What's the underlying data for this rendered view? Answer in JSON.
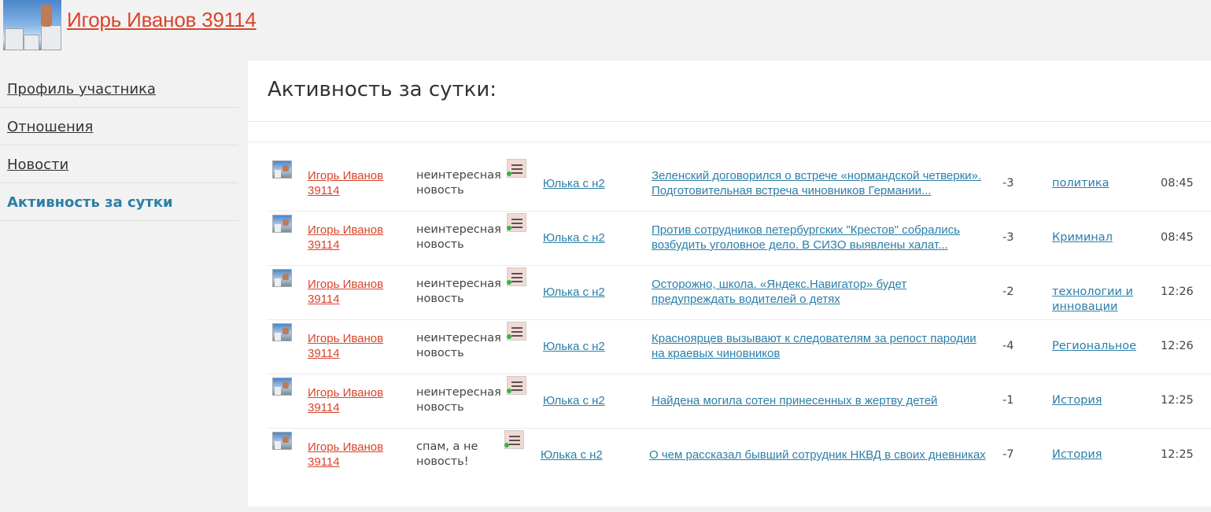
{
  "header": {
    "user_name": "Игорь Иванов 39114"
  },
  "sidebar": {
    "items": [
      {
        "label": "Профиль участника",
        "active": false
      },
      {
        "label": "Отношения",
        "active": false
      },
      {
        "label": "Новости",
        "active": false
      },
      {
        "label": "Активность за сутки",
        "active": true
      }
    ]
  },
  "main": {
    "title": "Активность за сутки:",
    "rows": [
      {
        "user": "Игорь Иванов 39114",
        "reason": "неинтересная новость",
        "voter": "Юлька с н2",
        "news": "Зеленский договорился о встрече «нормандской четверки». Подготовительная встреча чиновников Германии...",
        "score": "-3",
        "category": "политика",
        "time": "08:45"
      },
      {
        "user": "Игорь Иванов 39114",
        "reason": "неинтересная новость",
        "voter": "Юлька с н2",
        "news": "Против сотрудников петербургских \"Крестов\" собрались возбудить уголовное дело. В СИЗО выявлены халат...",
        "score": "-3",
        "category": "Криминал",
        "time": "08:45"
      },
      {
        "user": "Игорь Иванов 39114",
        "reason": "неинтересная новость",
        "voter": "Юлька с н2",
        "news": "Осторожно, школа. «Яндекс.Навигатор» будет предупреждать водителей о детях",
        "score": "-2",
        "category": "технологии и инновации",
        "time": "12:26"
      },
      {
        "user": "Игорь Иванов 39114",
        "reason": "неинтересная новость",
        "voter": "Юлька с н2",
        "news": "Красноярцев вызывают к следователям за репост пародии на краевых чиновников",
        "score": "-4",
        "category": "Региональное",
        "time": "12:26"
      },
      {
        "user": "Игорь Иванов 39114",
        "reason": "неинтересная новость",
        "voter": "Юлька с н2",
        "news": "Найдена могила сотен принесенных в жертву детей",
        "score": "-1",
        "category": "История",
        "time": "12:25"
      },
      {
        "user": "Игорь Иванов 39114",
        "reason": "спам, а не новость!",
        "voter": "Юлька с н2",
        "news": "О чем рассказал бывший сотрудник НКВД в своих дневниках",
        "score": "-7",
        "category": "История",
        "time": "12:25"
      }
    ]
  }
}
